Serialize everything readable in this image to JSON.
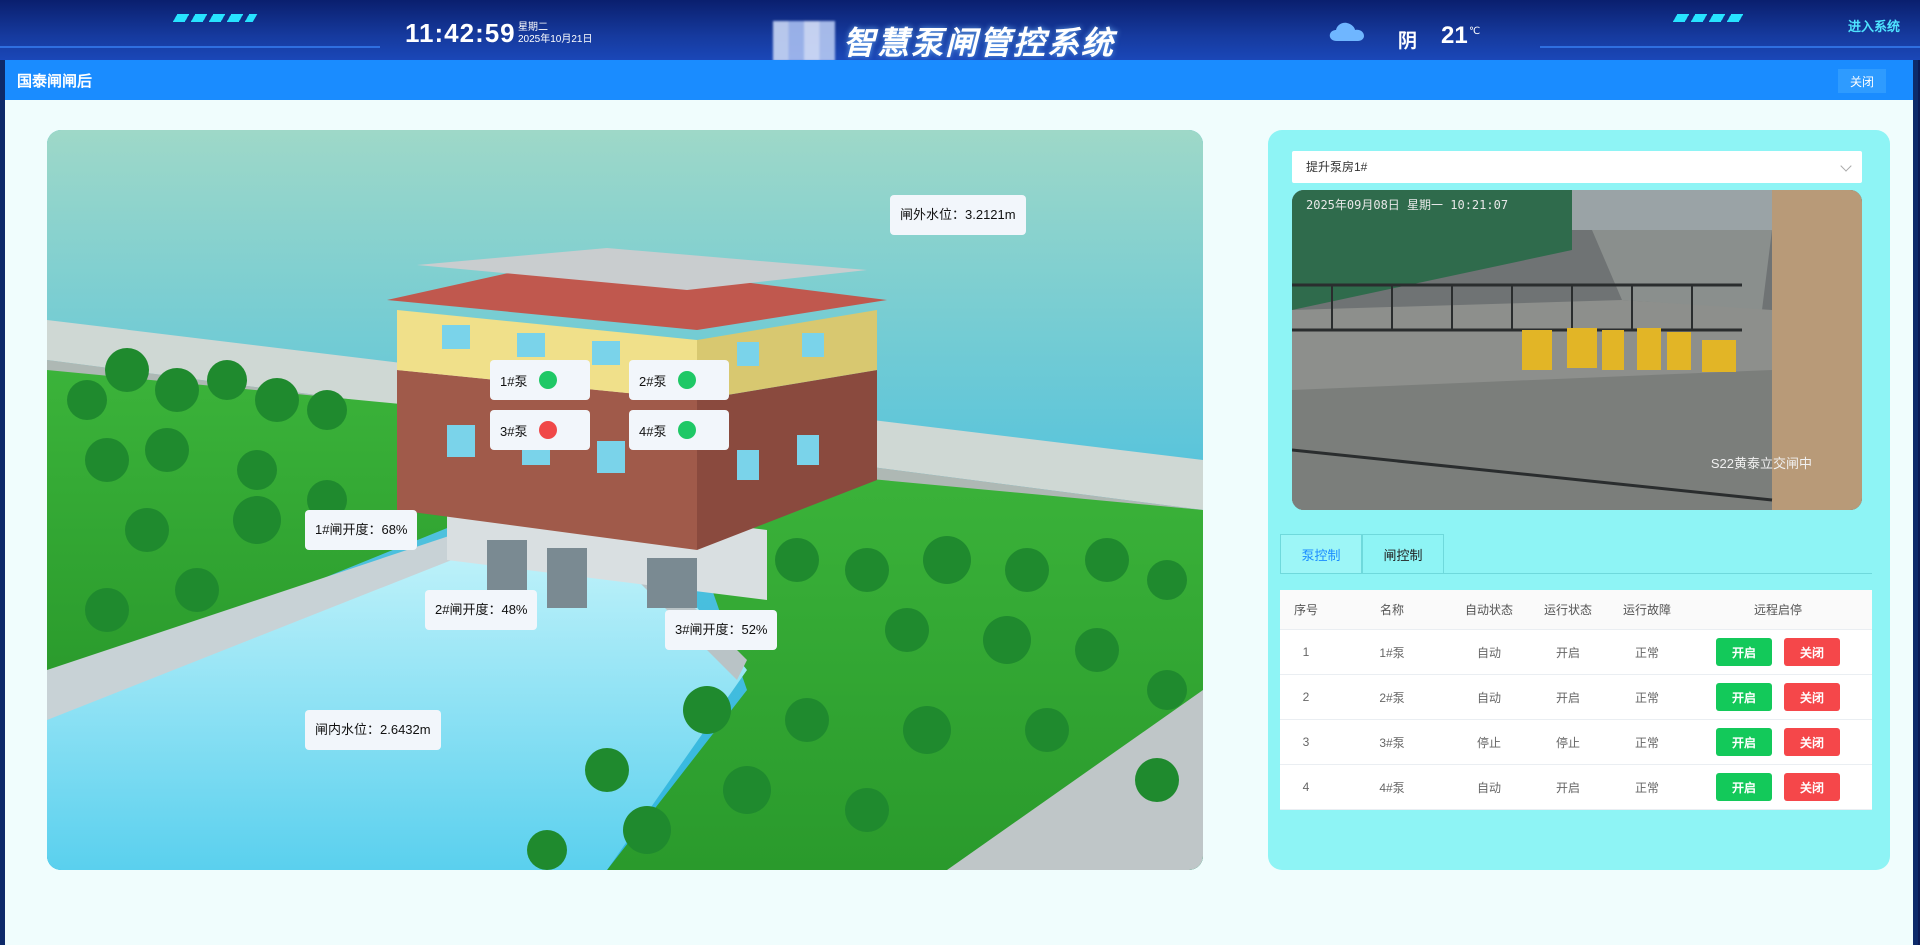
{
  "header": {
    "time": "11:42:59",
    "weekday": "星期二",
    "date": "2025年10月21日",
    "title": "智慧泵闸管控系统",
    "weather": "阴",
    "temperature": "21",
    "temp_unit": "℃",
    "enter_label": "进入系统",
    "weather_icon": "cloud-icon"
  },
  "modal": {
    "title": "国泰闸闸后",
    "close_label": "关闭"
  },
  "scene": {
    "outer_level": "闸外水位：3.2121m",
    "inner_level": "闸内水位：2.6432m",
    "gates": [
      {
        "label": "1#闸开度：68%",
        "open_percent": 68
      },
      {
        "label": "2#闸开度：48%",
        "open_percent": 48
      },
      {
        "label": "3#闸开度：52%",
        "open_percent": 52
      }
    ],
    "pumps": [
      {
        "label": "1#泵",
        "status_color": "#1fc866"
      },
      {
        "label": "2#泵",
        "status_color": "#1fc866"
      },
      {
        "label": "3#泵",
        "status_color": "#f04848"
      },
      {
        "label": "4#泵",
        "status_color": "#1fc866"
      }
    ]
  },
  "panel": {
    "station_select": "提升泵房1#",
    "camera_timestamp": "2025年09月08日 星期一 10:21:07",
    "camera_location": "S22黄泰立交闸中",
    "tabs": [
      {
        "label": "泵控制",
        "active": true
      },
      {
        "label": "闸控制",
        "active": false
      }
    ],
    "table": {
      "headers": [
        "序号",
        "名称",
        "自动状态",
        "运行状态",
        "运行故障",
        "远程启停"
      ],
      "rows": [
        [
          "1",
          "1#泵",
          "自动",
          "开启",
          "正常"
        ],
        [
          "2",
          "2#泵",
          "自动",
          "开启",
          "正常"
        ],
        [
          "3",
          "3#泵",
          "停止",
          "停止",
          "正常"
        ],
        [
          "4",
          "4#泵",
          "自动",
          "开启",
          "正常"
        ]
      ],
      "on_label": "开启",
      "off_label": "关闭"
    }
  },
  "colors": {
    "accent": "#1a8cff",
    "on": "#13c95a",
    "off": "#f5474a",
    "panel_bg": "#8ef4f5"
  }
}
